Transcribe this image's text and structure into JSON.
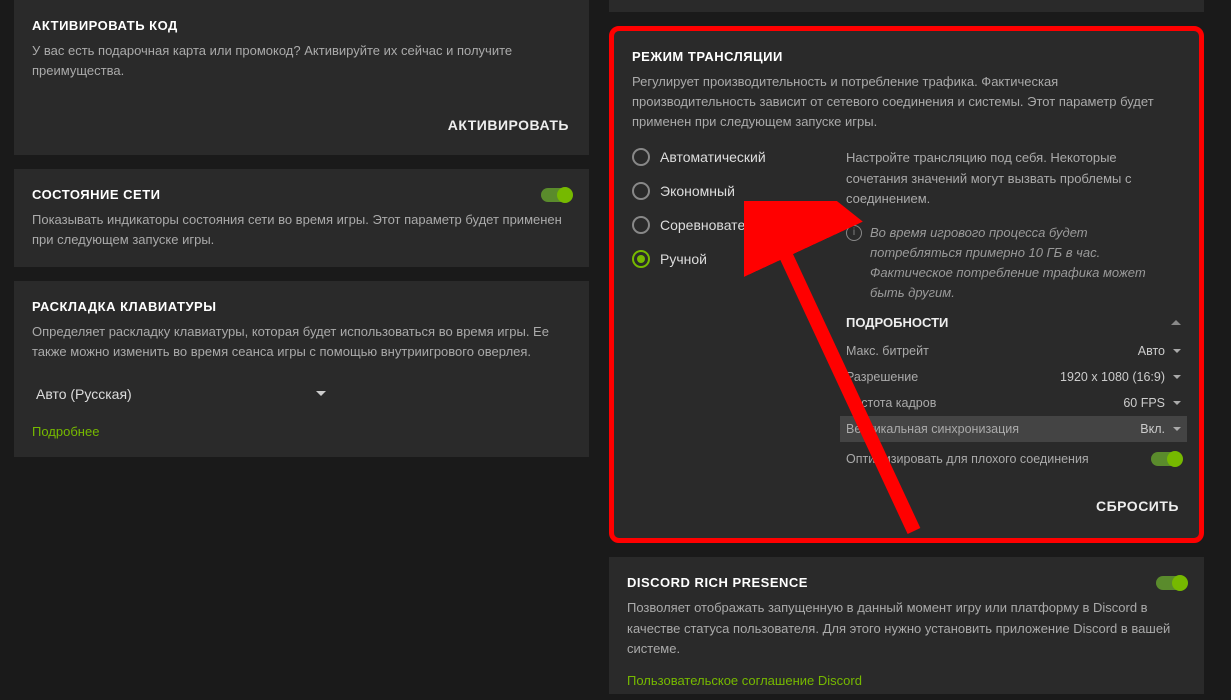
{
  "activate": {
    "title": "АКТИВИРОВАТЬ КОД",
    "desc": "У вас есть подарочная карта или промокод? Активируйте их сейчас и получите преимущества.",
    "button": "АКТИВИРОВАТЬ"
  },
  "network": {
    "title": "СОСТОЯНИЕ СЕТИ",
    "desc": "Показывать индикаторы состояния сети во время игры. Этот параметр будет применен при следующем запуске игры.",
    "enabled": true
  },
  "keyboard": {
    "title": "РАСКЛАДКА КЛАВИАТУРЫ",
    "desc": "Определяет раскладку клавиатуры, которая будет использоваться во время игры. Ее также можно изменить во время сеанса игры с помощью внутриигрового оверлея.",
    "value": "Авто (Русская)",
    "link": "Подробнее"
  },
  "streaming": {
    "title": "РЕЖИМ ТРАНСЛЯЦИИ",
    "desc": "Регулирует производительность и потребление трафика. Фактическая производительность зависит от сетевого соединения и системы. Этот параметр будет применен при следующем запуске игры.",
    "modes": {
      "auto": "Автоматический",
      "eco": "Экономный",
      "comp": "Соревновательный",
      "manual": "Ручной"
    },
    "selected": "manual",
    "hint_main": "Настройте трансляцию под себя. Некоторые сочетания значений могут вызвать проблемы с соединением.",
    "hint_info": "Во время игрового процесса будет потребляться примерно 10 ГБ в час. Фактическое потребление трафика может быть другим.",
    "details": {
      "title": "ПОДРОБНОСТИ",
      "bitrate_label": "Макс. битрейт",
      "bitrate_value": "Авто",
      "resolution_label": "Разрешение",
      "resolution_value": "1920 x 1080 (16:9)",
      "fps_label": "Частота кадров",
      "fps_value": "60 FPS",
      "vsync_label": "Вертикальная синхронизация",
      "vsync_value": "Вкл.",
      "optimize_label": "Оптимизировать для плохого соединения",
      "optimize_enabled": true
    },
    "reset": "СБРОСИТЬ"
  },
  "discord": {
    "title": "DISCORD RICH PRESENCE",
    "desc": "Позволяет отображать запущенную в данный момент игру или платформу в Discord в качестве статуса пользователя. Для этого нужно установить приложение Discord в вашей системе.",
    "link": "Пользовательское соглашение Discord",
    "enabled": true
  }
}
